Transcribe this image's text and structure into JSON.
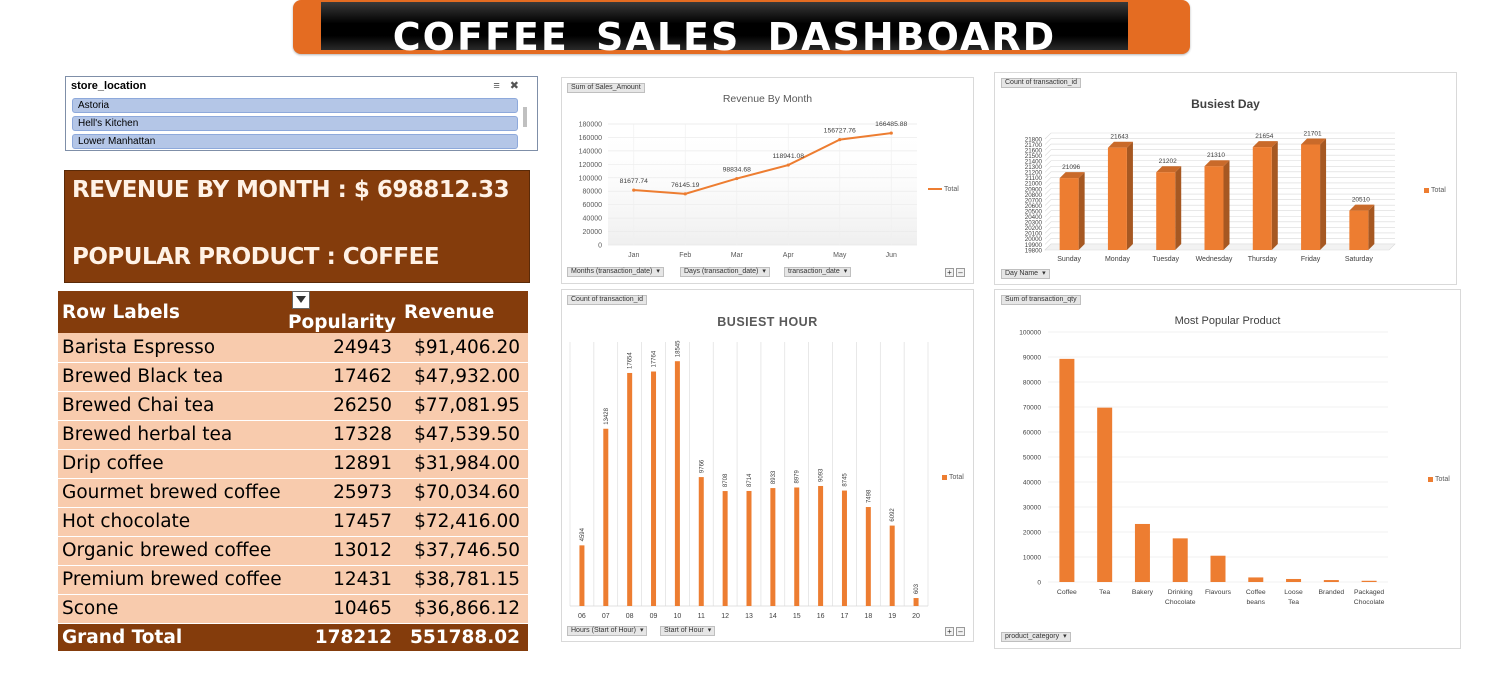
{
  "banner": {
    "title": "COFFEE  SALES  DASHBOARD"
  },
  "slicer": {
    "header": "store_location",
    "items": [
      "Astoria",
      "Hell's Kitchen",
      "Lower Manhattan"
    ]
  },
  "kpi": {
    "revenue_line": "REVENUE BY MONTH : $ 698812.33",
    "product_line": "POPULAR PRODUCT : COFFEE"
  },
  "pivot": {
    "headers": [
      "Row Labels",
      "Popularity",
      "Revenue"
    ],
    "rows": [
      {
        "label": "Barista Espresso",
        "popularity": "24943",
        "revenue": "$91,406.20"
      },
      {
        "label": "Brewed Black tea",
        "popularity": "17462",
        "revenue": "$47,932.00"
      },
      {
        "label": "Brewed Chai tea",
        "popularity": "26250",
        "revenue": "$77,081.95"
      },
      {
        "label": "Brewed herbal tea",
        "popularity": "17328",
        "revenue": "$47,539.50"
      },
      {
        "label": "Drip coffee",
        "popularity": "12891",
        "revenue": "$31,984.00"
      },
      {
        "label": "Gourmet brewed coffee",
        "popularity": "25973",
        "revenue": "$70,034.60"
      },
      {
        "label": "Hot chocolate",
        "popularity": "17457",
        "revenue": "$72,416.00"
      },
      {
        "label": "Organic brewed coffee",
        "popularity": "13012",
        "revenue": "$37,746.50"
      },
      {
        "label": "Premium brewed coffee",
        "popularity": "12431",
        "revenue": "$38,781.15"
      },
      {
        "label": "Scone",
        "popularity": "10465",
        "revenue": "$36,866.12"
      }
    ],
    "total": {
      "label": "Grand Total",
      "popularity": "178212",
      "revenue": "551788.02"
    }
  },
  "colors": {
    "accent": "#ed7d31",
    "brown": "#843c0c",
    "peach": "#f8cbad",
    "slicer_item": "#b4c6e7"
  },
  "chart_data": [
    {
      "id": "revenue_by_month",
      "type": "line",
      "title": "Revenue By Month",
      "value_field": "Sum of Sales_Amount",
      "categories": [
        "Jan",
        "Feb",
        "Mar",
        "Apr",
        "May",
        "Jun"
      ],
      "series": [
        {
          "name": "Total",
          "values": [
            81677.74,
            76145.19,
            98834.68,
            118941.08,
            156727.76,
            166485.88
          ]
        }
      ],
      "data_labels": [
        "81677.74",
        "76145.19",
        "98834.68",
        "118941.08",
        "156727.76",
        "166485.88"
      ],
      "ylim": [
        0,
        180000
      ],
      "yticks": [
        "0",
        "20000",
        "40000",
        "60000",
        "80000",
        "100000",
        "120000",
        "140000",
        "160000",
        "180000"
      ],
      "grid": true,
      "legend": "right",
      "field_buttons": [
        "Months (transaction_date)",
        "Days (transaction_date)",
        "transaction_date"
      ]
    },
    {
      "id": "busiest_day",
      "type": "bar",
      "title": "Busiest Day",
      "value_field": "Count of transaction_id",
      "categories": [
        "Sunday",
        "Monday",
        "Tuesday",
        "Wednesday",
        "Thursday",
        "Friday",
        "Saturday"
      ],
      "series": [
        {
          "name": "Total",
          "values": [
            21096,
            21643,
            21202,
            21310,
            21654,
            21701,
            20510
          ]
        }
      ],
      "data_labels": [
        "21096",
        "21643",
        "21202",
        "21310",
        "21654",
        "21701",
        "20510"
      ],
      "ylim": [
        19800,
        21800
      ],
      "yticks": [
        "19800",
        "19900",
        "20000",
        "20100",
        "20200",
        "20300",
        "20400",
        "20500",
        "20600",
        "20700",
        "20800",
        "20900",
        "21000",
        "21100",
        "21200",
        "21300",
        "21400",
        "21500",
        "21600",
        "21700",
        "21800"
      ],
      "grid": true,
      "legend": "right",
      "field_buttons": [
        "Day Name"
      ]
    },
    {
      "id": "busiest_hour",
      "type": "bar",
      "title": "BUSIEST HOUR",
      "value_field": "Count of transaction_id",
      "categories": [
        "06",
        "07",
        "08",
        "09",
        "10",
        "11",
        "12",
        "13",
        "14",
        "15",
        "16",
        "17",
        "18",
        "19",
        "20"
      ],
      "series": [
        {
          "name": "Total",
          "values": [
            4594,
            13428,
            17654,
            17764,
            18545,
            9766,
            8708,
            8714,
            8933,
            8979,
            9093,
            8745,
            7498,
            6092,
            603
          ]
        }
      ],
      "data_labels": [
        "4594",
        "13428",
        "17654",
        "17764",
        "18545",
        "9766",
        "8708",
        "8714",
        "8933",
        "8979",
        "9093",
        "8745",
        "7498",
        "6092",
        "603"
      ],
      "ylim": [
        0,
        20000
      ],
      "grid": true,
      "legend": "right",
      "field_buttons": [
        "Hours (Start of Hour)",
        "Start of Hour"
      ]
    },
    {
      "id": "most_popular_product",
      "type": "bar",
      "title": "Most Popular Product",
      "value_field": "Sum of transaction_qty",
      "categories": [
        "Coffee",
        "Tea",
        "Bakery",
        "Drinking Chocolate",
        "Flavours",
        "Coffee beans",
        "Loose Tea",
        "Branded",
        "Packaged Chocolate"
      ],
      "series": [
        {
          "name": "Total",
          "values": [
            89250,
            69737,
            23214,
            17457,
            10511,
            1828,
            1210,
            776,
            487
          ]
        }
      ],
      "ylim": [
        0,
        100000
      ],
      "yticks": [
        "0",
        "10000",
        "20000",
        "30000",
        "40000",
        "50000",
        "60000",
        "70000",
        "80000",
        "90000",
        "100000"
      ],
      "grid": true,
      "legend": "right",
      "field_buttons": [
        "product_category"
      ]
    }
  ]
}
